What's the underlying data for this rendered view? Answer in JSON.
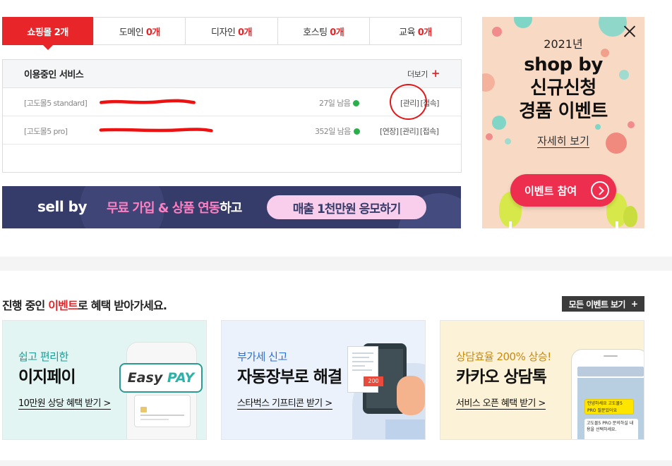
{
  "tabs": [
    {
      "label": "쇼핑몰",
      "count": "2개",
      "active": true
    },
    {
      "label": "도메인",
      "count": "0개"
    },
    {
      "label": "디자인",
      "count": "0개"
    },
    {
      "label": "호스팅",
      "count": "0개"
    },
    {
      "label": "교육",
      "count": "0개"
    }
  ],
  "service": {
    "title": "이용중인 서비스",
    "more_label": "더보기",
    "rows": [
      {
        "plan": "[고도몰5 standard]",
        "days": "27일 남음",
        "links": [
          "[관리]",
          "[접속]"
        ]
      },
      {
        "plan": "[고도몰5 pro]",
        "days": "352일 남음",
        "links": [
          "[연장]",
          "[관리]",
          "[접속]"
        ]
      }
    ]
  },
  "sellby_banner": {
    "logo": "sell by",
    "slogan_highlight": "무료 가입 & 상품 연동",
    "slogan_rest": "하고",
    "cta": "매출 1천만원 응모하기"
  },
  "event_ad": {
    "year": "2021년",
    "headline_1": "shop by",
    "headline_2": "신규신청",
    "headline_3": "경품 이벤트",
    "detail_link": "자세히 보기",
    "button": "이벤트 참여"
  },
  "events": {
    "title_prefix": "진행 중인 ",
    "title_highlight": "이벤트",
    "title_suffix": "로 혜택 받아가세요.",
    "all_button": "모든 이벤트 보기",
    "cards": [
      {
        "sub": "쉽고 편리한",
        "main": "이지페이",
        "link": "10만원 상당 혜택 받기 >",
        "badge_1": "Easy",
        "badge_2": "PAY"
      },
      {
        "sub": "부가세 신고",
        "main": "자동장부로 해결",
        "link": "스타벅스 기프티콘 받기 >",
        "receipt_tag": "200"
      },
      {
        "sub": "상담효율 200% 상승!",
        "main": "카카오 상담톡",
        "link": "서비스 오픈 혜택 받기 >",
        "chat_1": "안녕하세요 고도몰5 PRO 질문있어요",
        "chat_2": "고도몰5 PRO 문의하실 내용을 선택하세요."
      }
    ]
  },
  "colors": {
    "accent": "#e8262a",
    "status_ok": "#2ab04a",
    "sellby_bg": "#363c69"
  },
  "icons": [
    "plus-icon",
    "status-dot-icon",
    "close-icon",
    "arrow-circle-icon"
  ]
}
